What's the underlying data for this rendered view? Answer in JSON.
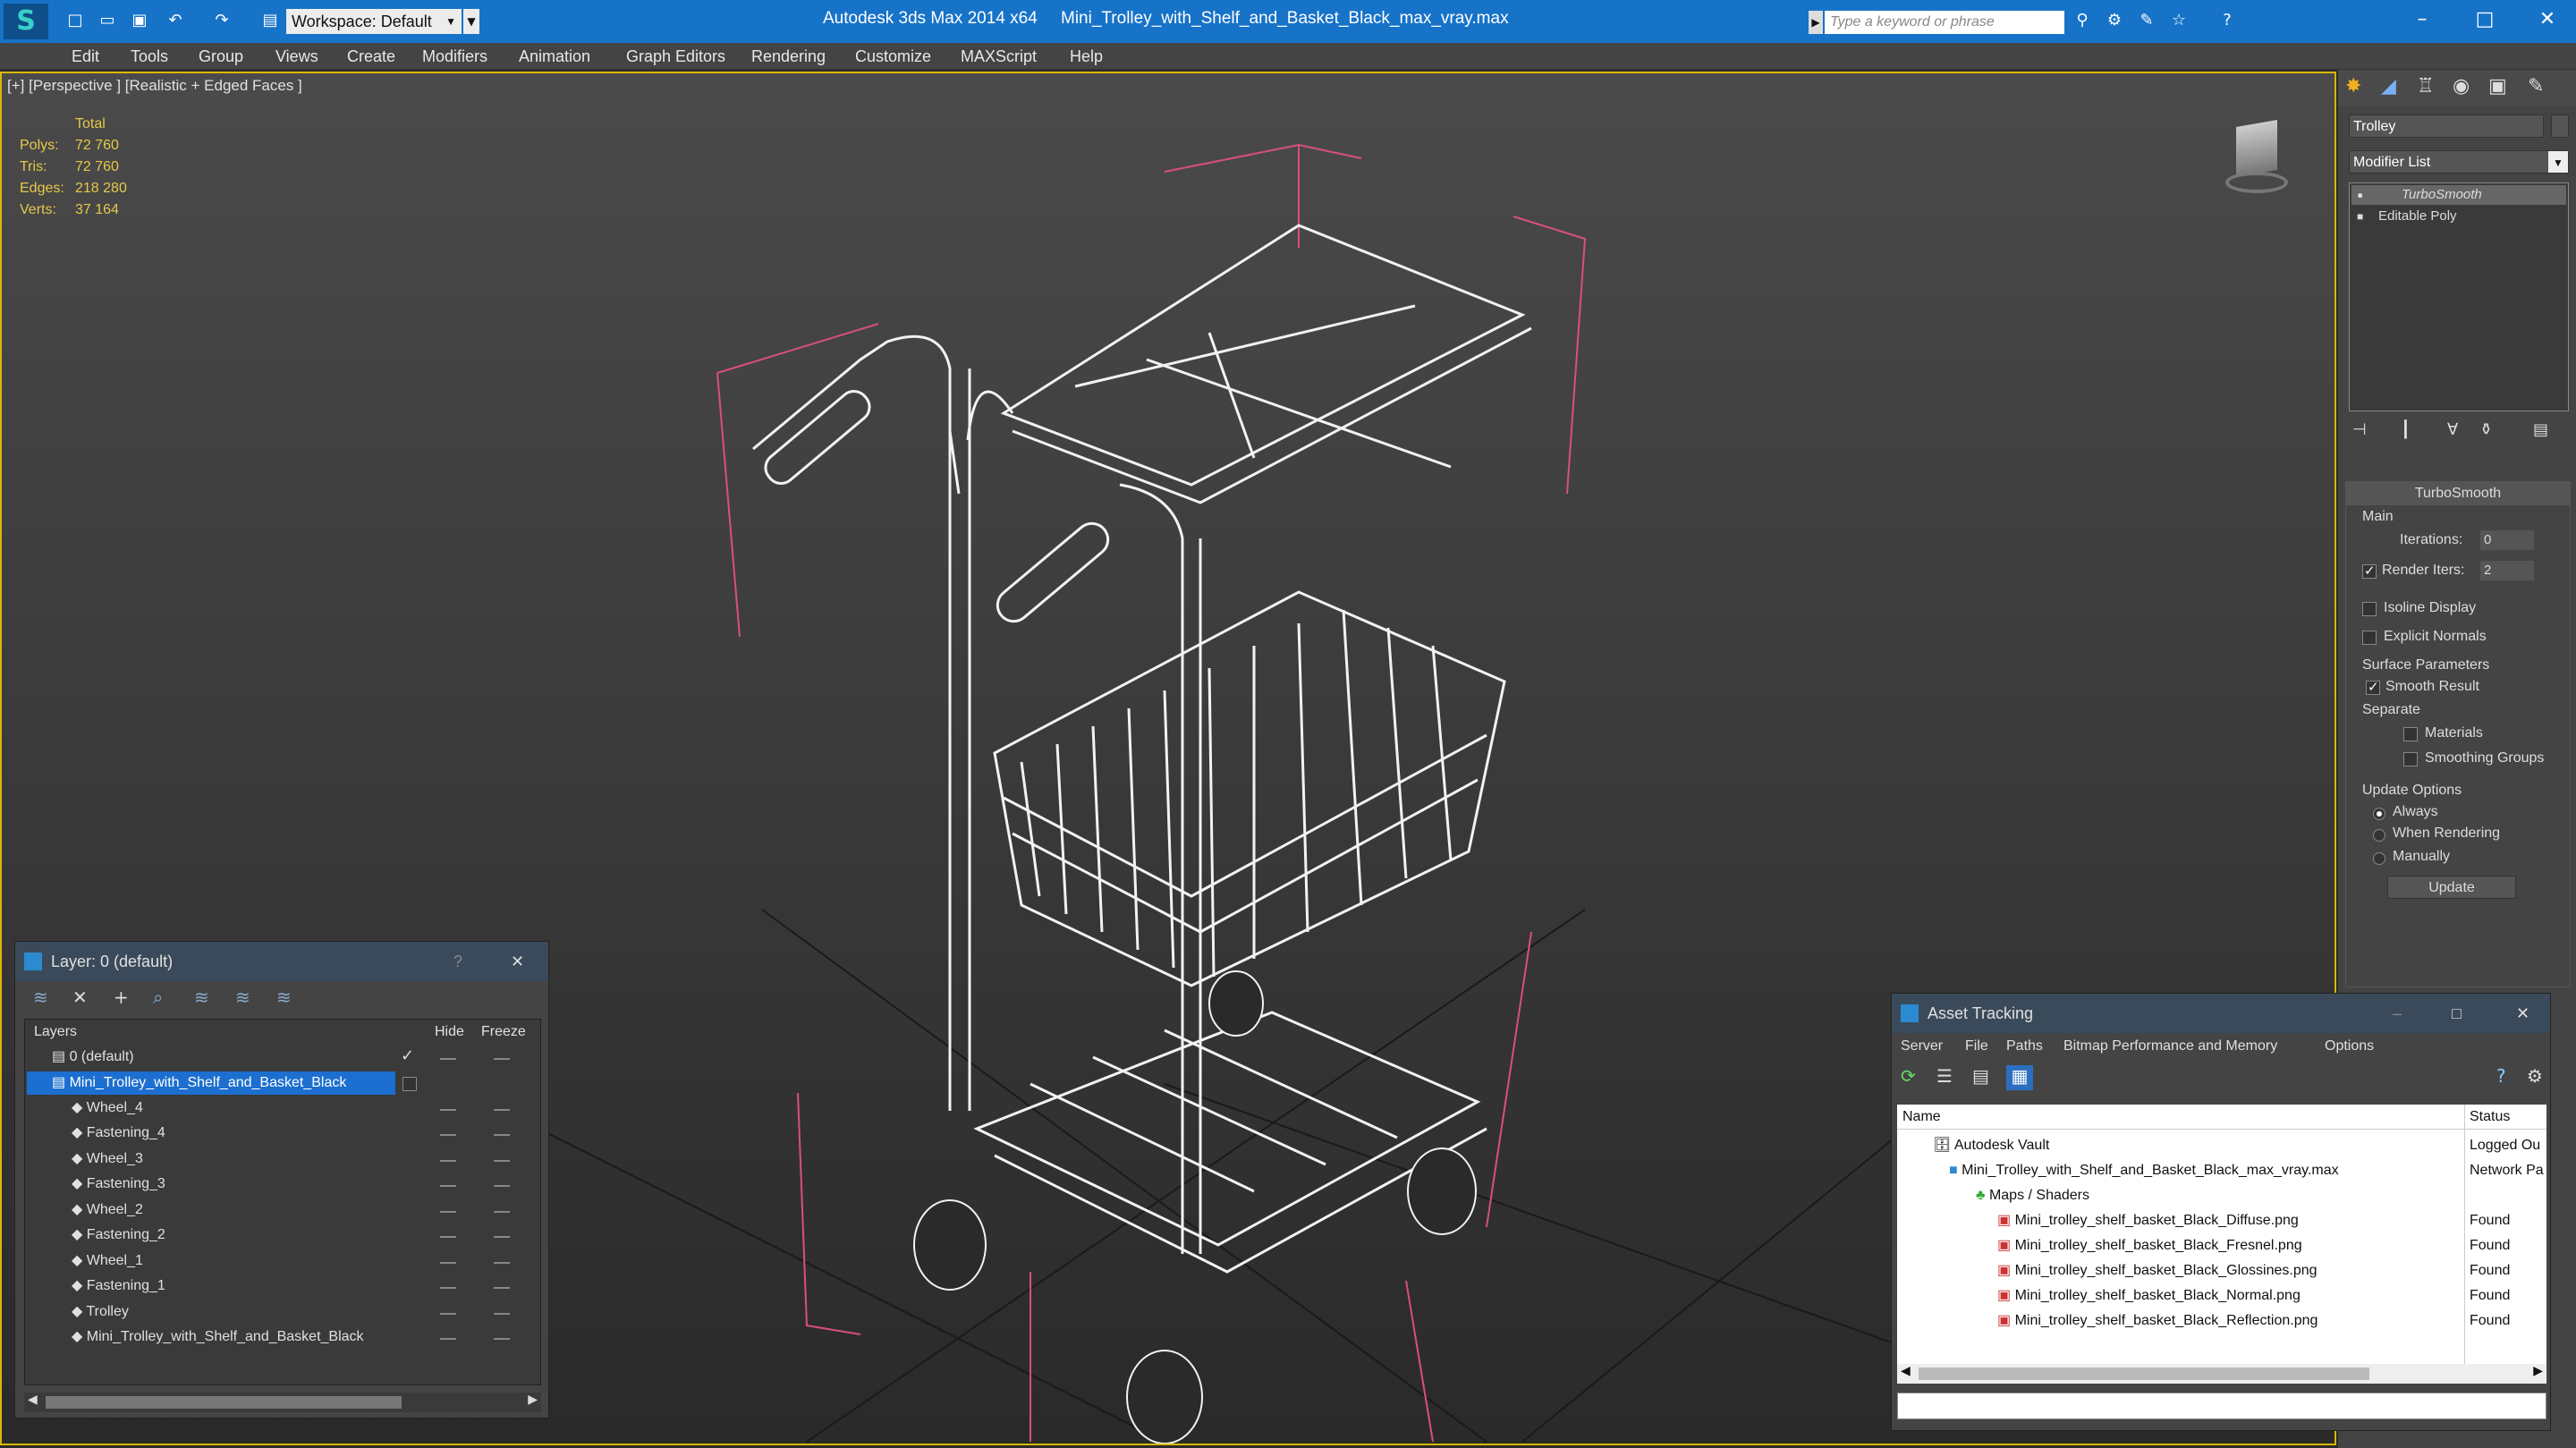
{
  "titlebar": {
    "workspace": "Workspace: Default",
    "app_title": "Autodesk 3ds Max  2014 x64",
    "file_title": "Mini_Trolley_with_Shelf_and_Basket_Black_max_vray.max",
    "search_placeholder": "Type a keyword or phrase"
  },
  "menu": [
    "Edit",
    "Tools",
    "Group",
    "Views",
    "Create",
    "Modifiers",
    "Animation",
    "Graph Editors",
    "Rendering",
    "Customize",
    "MAXScript",
    "Help"
  ],
  "viewport": {
    "label": "[+] [Perspective ] [Realistic + Edged Faces ]",
    "stats": {
      "total": "Total",
      "polys_label": "Polys:",
      "polys": "72 760",
      "tris_label": "Tris:",
      "tris": "72 760",
      "edges_label": "Edges:",
      "edges": "218 280",
      "verts_label": "Verts:",
      "verts": "37 164"
    }
  },
  "command_panel": {
    "object_name": "Trolley",
    "modifier_list": "Modifier List",
    "stack": [
      "TurboSmooth",
      "Editable Poly"
    ],
    "rollout_title": "TurboSmooth",
    "main_group": "Main",
    "iterations_label": "Iterations:",
    "iterations": "0",
    "render_iters_label": "Render Iters:",
    "render_iters": "2",
    "isoline": "Isoline Display",
    "explicit": "Explicit Normals",
    "surface_group": "Surface Parameters",
    "smooth_result": "Smooth Result",
    "separate": "Separate",
    "materials": "Materials",
    "smoothing_groups": "Smoothing Groups",
    "update_group": "Update Options",
    "always": "Always",
    "when_rendering": "When Rendering",
    "manually": "Manually",
    "update_button": "Update"
  },
  "layer_panel": {
    "title": "Layer: 0 (default)",
    "col_layers": "Layers",
    "col_hide": "Hide",
    "col_freeze": "Freeze",
    "rows": [
      "0 (default)",
      "Mini_Trolley_with_Shelf_and_Basket_Black",
      "Wheel_4",
      "Fastening_4",
      "Wheel_3",
      "Fastening_3",
      "Wheel_2",
      "Fastening_2",
      "Wheel_1",
      "Fastening_1",
      "Trolley",
      "Mini_Trolley_with_Shelf_and_Basket_Black"
    ]
  },
  "asset_panel": {
    "title": "Asset Tracking",
    "menu": [
      "Server",
      "File",
      "Paths",
      "Bitmap Performance and Memory",
      "Options"
    ],
    "col_name": "Name",
    "col_status": "Status",
    "rows": [
      {
        "name": "Autodesk Vault",
        "status": "Logged Ou"
      },
      {
        "name": "Mini_Trolley_with_Shelf_and_Basket_Black_max_vray.max",
        "status": "Network Pa"
      },
      {
        "name": "Maps / Shaders",
        "status": ""
      },
      {
        "name": "Mini_trolley_shelf_basket_Black_Diffuse.png",
        "status": "Found"
      },
      {
        "name": "Mini_trolley_shelf_basket_Black_Fresnel.png",
        "status": "Found"
      },
      {
        "name": "Mini_trolley_shelf_basket_Black_Glossines.png",
        "status": "Found"
      },
      {
        "name": "Mini_trolley_shelf_basket_Black_Normal.png",
        "status": "Found"
      },
      {
        "name": "Mini_trolley_shelf_basket_Black_Reflection.png",
        "status": "Found"
      }
    ]
  }
}
